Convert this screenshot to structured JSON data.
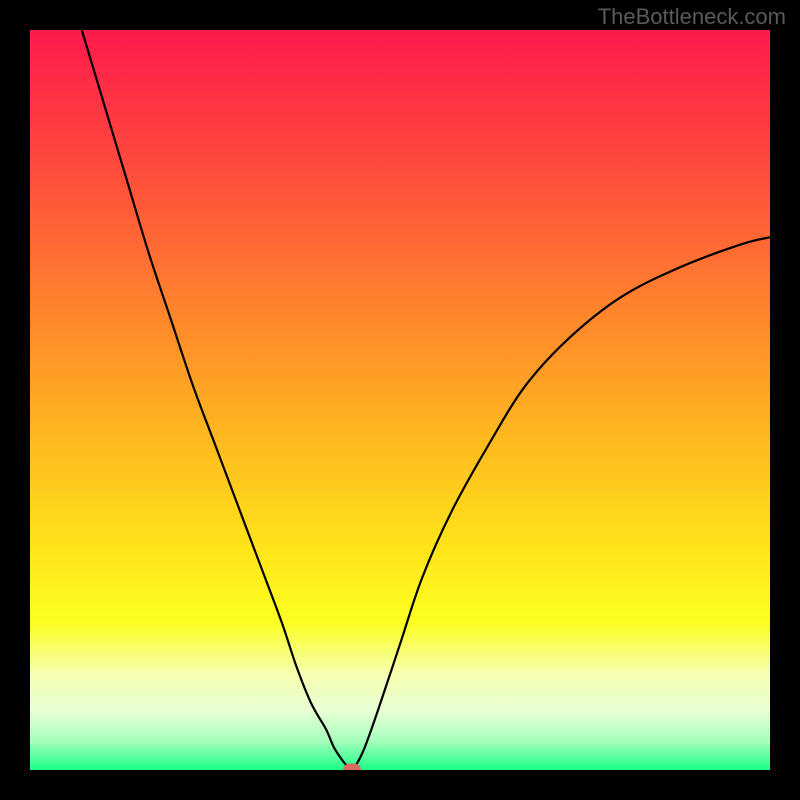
{
  "watermark": "TheBottleneck.com",
  "chart_data": {
    "type": "line",
    "title": "",
    "xlabel": "",
    "ylabel": "",
    "xlim": [
      0,
      100
    ],
    "ylim": [
      0,
      100
    ],
    "gradient_stops": [
      {
        "offset": 0,
        "color": "#ff1a4c"
      },
      {
        "offset": 0.2,
        "color": "#ff4f3b"
      },
      {
        "offset": 0.4,
        "color": "#ff8a2a"
      },
      {
        "offset": 0.55,
        "color": "#ffb81f"
      },
      {
        "offset": 0.7,
        "color": "#ffe41a"
      },
      {
        "offset": 0.8,
        "color": "#fcff20"
      },
      {
        "offset": 0.87,
        "color": "#f6ffb0"
      },
      {
        "offset": 0.92,
        "color": "#e8ffd4"
      },
      {
        "offset": 0.96,
        "color": "#a7ffbc"
      },
      {
        "offset": 1.0,
        "color": "#1bff87"
      }
    ],
    "series": [
      {
        "name": "bottleneck-curve",
        "x": [
          7,
          10,
          13,
          16,
          19,
          22,
          25,
          28,
          31,
          34,
          36,
          38,
          40,
          41,
          42,
          42.8,
          43.5,
          45,
          47,
          50,
          53,
          57,
          62,
          67,
          73,
          80,
          88,
          96,
          100
        ],
        "y": [
          100,
          90,
          80,
          70,
          61,
          52,
          44,
          36,
          28,
          20,
          14,
          9,
          5.5,
          3.2,
          1.6,
          0.6,
          0.0,
          2.5,
          8,
          17,
          26,
          35,
          44,
          52,
          58.5,
          64,
          68,
          71,
          72
        ],
        "stroke": "#000000",
        "stroke_width": 2.2
      }
    ],
    "marker": {
      "x": 43.5,
      "y": 0.0,
      "color": "#d66b60"
    }
  }
}
